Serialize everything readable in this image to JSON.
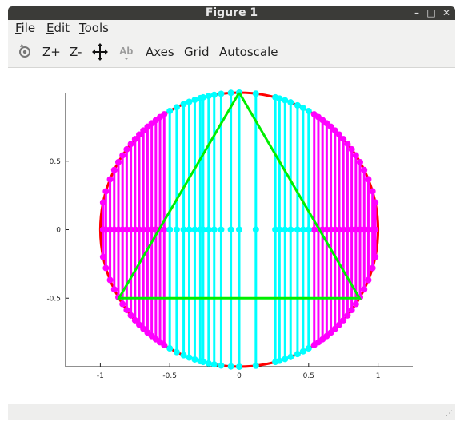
{
  "window": {
    "title": "Figure 1",
    "buttons": [
      "–",
      "□",
      "✕"
    ]
  },
  "menu": [
    {
      "first": "F",
      "rest": "ile"
    },
    {
      "first": "E",
      "rest": "dit"
    },
    {
      "first": "T",
      "rest": "ools"
    }
  ],
  "toolbar": {
    "zoom_in": "Z+",
    "zoom_out": "Z-",
    "axes": "Axes",
    "grid": "Grid",
    "autoscale": "Autoscale",
    "text_icon": "Ab"
  },
  "chart_data": {
    "type": "line",
    "title": "",
    "xlabel": "",
    "ylabel": "",
    "xlim": [
      -1.25,
      1.25
    ],
    "ylim": [
      -1,
      1
    ],
    "xticks": [
      "-1",
      "-0.5",
      "0",
      "0.5",
      "1"
    ],
    "yticks": [
      "-0.5",
      "0",
      "0.5"
    ],
    "xtick_values": [
      -1,
      -0.5,
      0,
      0.5,
      1
    ],
    "ytick_values": [
      -0.5,
      0,
      0.5
    ],
    "series": [
      {
        "kind": "circle",
        "color": "#ff0000",
        "center": [
          0,
          0
        ],
        "radius": 1
      },
      {
        "kind": "triangle",
        "color": "#00ee00",
        "x": [
          0,
          0.866,
          -0.866,
          0
        ],
        "y": [
          1,
          -0.5,
          -0.5,
          1
        ]
      },
      {
        "kind": "stems",
        "color": "#ff00ff",
        "x": [
          -0.98,
          -0.96,
          -0.93,
          -0.9,
          -0.87,
          -0.84,
          -0.81,
          -0.78,
          -0.75,
          -0.72,
          -0.69,
          -0.66,
          -0.63,
          -0.6,
          -0.57,
          -0.54,
          0.54,
          0.57,
          0.6,
          0.63,
          0.66,
          0.69,
          0.72,
          0.75,
          0.78,
          0.81,
          0.84,
          0.87,
          0.9,
          0.93,
          0.96,
          0.98
        ]
      },
      {
        "kind": "stems",
        "color": "#00ffff",
        "x": [
          -0.5,
          -0.45,
          -0.4,
          -0.36,
          -0.32,
          -0.28,
          -0.26,
          -0.22,
          -0.18,
          -0.13,
          -0.06,
          0,
          0.12,
          0.26,
          0.29,
          0.33,
          0.37,
          0.42,
          0.46,
          0.5
        ]
      }
    ]
  }
}
